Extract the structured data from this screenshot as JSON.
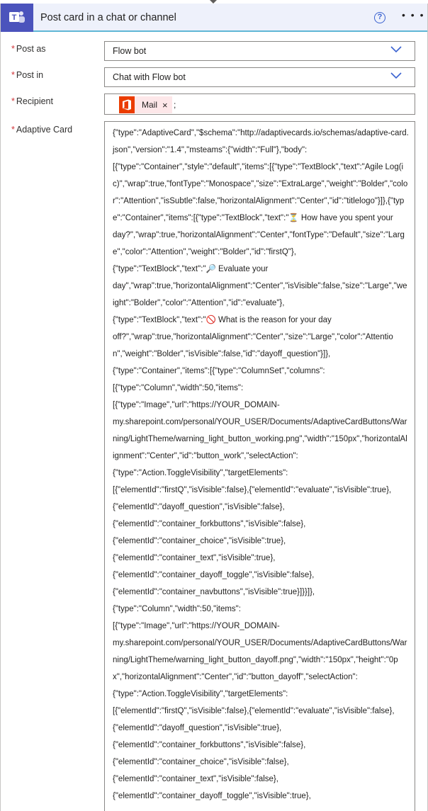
{
  "header": {
    "title": "Post card in a chat or channel",
    "help_icon": "help-circle-icon",
    "more_icon": "ellipsis-icon",
    "app_icon": "teams-icon",
    "brand_color": "#4b53bc"
  },
  "fields": {
    "post_as": {
      "label": "Post as",
      "value": "Flow bot"
    },
    "post_in": {
      "label": "Post in",
      "value": "Chat with Flow bot"
    },
    "recipient": {
      "label": "Recipient",
      "token": "Mail",
      "separator": ";"
    },
    "adaptive_card": {
      "label": "Adaptive Card",
      "value": "{\"type\":\"AdaptiveCard\",\"$schema\":\"http://adaptivecards.io/schemas/adaptive-card.json\",\"version\":\"1.4\",\"msteams\":{\"width\":\"Full\"},\"body\":\n[{\"type\":\"Container\",\"style\":\"default\",\"items\":[{\"type\":\"TextBlock\",\"text\":\"Agile Log(ic)\",\"wrap\":true,\"fontType\":\"Monospace\",\"size\":\"ExtraLarge\",\"weight\":\"Bolder\",\"color\":\"Attention\",\"isSubtle\":false,\"horizontalAlignment\":\"Center\",\"id\":\"titlelogo\"}]},{\"type\":\"Container\",\"items\":[{\"type\":\"TextBlock\",\"text\":\"⏳ How have you spent your\nday?\",\"wrap\":true,\"horizontalAlignment\":\"Center\",\"fontType\":\"Default\",\"size\":\"Large\",\"color\":\"Attention\",\"weight\":\"Bolder\",\"id\":\"firstQ\"},\n{\"type\":\"TextBlock\",\"text\":\"🔎 Evaluate your\nday\",\"wrap\":true,\"horizontalAlignment\":\"Center\",\"isVisible\":false,\"size\":\"Large\",\"weight\":\"Bolder\",\"color\":\"Attention\",\"id\":\"evaluate\"},\n{\"type\":\"TextBlock\",\"text\":\"🚫 What is the reason for your day\noff?\",\"wrap\":true,\"horizontalAlignment\":\"Center\",\"size\":\"Large\",\"color\":\"Attention\",\"weight\":\"Bolder\",\"isVisible\":false,\"id\":\"dayoff_question\"}]},\n{\"type\":\"Container\",\"items\":[{\"type\":\"ColumnSet\",\"columns\":\n[{\"type\":\"Column\",\"width\":50,\"items\":\n[{\"type\":\"Image\",\"url\":\"https://YOUR_DOMAIN-\nmy.sharepoint.com/personal/YOUR_USER/Documents/AdaptiveCardButtons/Warning/LightTheme/warning_light_button_working.png\",\"width\":\"150px\",\"horizontalAlignment\":\"Center\",\"id\":\"button_work\",\"selectAction\":\n{\"type\":\"Action.ToggleVisibility\",\"targetElements\":\n[{\"elementId\":\"firstQ\",\"isVisible\":false},{\"elementId\":\"evaluate\",\"isVisible\":true},\n{\"elementId\":\"dayoff_question\",\"isVisible\":false},\n{\"elementId\":\"container_forkbuttons\",\"isVisible\":false},\n{\"elementId\":\"container_choice\",\"isVisible\":true},\n{\"elementId\":\"container_text\",\"isVisible\":true},\n{\"elementId\":\"container_dayoff_toggle\",\"isVisible\":false},\n{\"elementId\":\"container_navbuttons\",\"isVisible\":true}]}}]},\n{\"type\":\"Column\",\"width\":50,\"items\":\n[{\"type\":\"Image\",\"url\":\"https://YOUR_DOMAIN-\nmy.sharepoint.com/personal/YOUR_USER/Documents/AdaptiveCardButtons/Warning/LightTheme/warning_light_button_dayoff.png\",\"width\":\"150px\",\"height\":\"0px\",\"horizontalAlignment\":\"Center\",\"id\":\"button_dayoff\",\"selectAction\":\n{\"type\":\"Action.ToggleVisibility\",\"targetElements\":\n[{\"elementId\":\"firstQ\",\"isVisible\":false},{\"elementId\":\"evaluate\",\"isVisible\":false},\n{\"elementId\":\"dayoff_question\",\"isVisible\":true},\n{\"elementId\":\"container_forkbuttons\",\"isVisible\":false},\n{\"elementId\":\"container_choice\",\"isVisible\":false},\n{\"elementId\":\"container_text\",\"isVisible\":false},\n{\"elementId\":\"container_dayoff_toggle\",\"isVisible\":true},"
    }
  },
  "colors": {
    "header_bg": "#eef1fb",
    "header_underline": "#5fb7d6",
    "required_marker": "#d13438",
    "chevron": "#3a62d0",
    "token_bg": "#fde7e9",
    "office_icon": "#eb3c00"
  }
}
